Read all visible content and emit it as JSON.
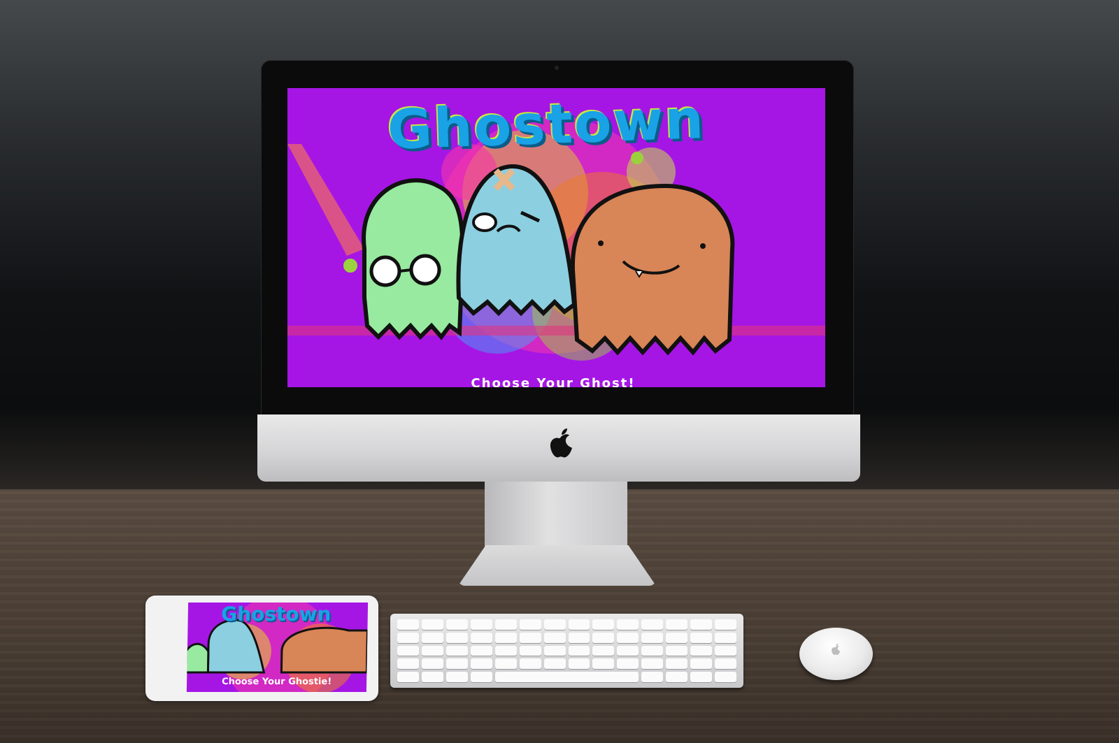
{
  "scene": {
    "imac_screen": {
      "title": "Ghostown",
      "caption": "Choose Your Ghost!"
    },
    "ipad_screen": {
      "title": "Ghostown",
      "caption": "Choose Your Ghostie!"
    }
  },
  "characters": [
    {
      "name": "green-ghost",
      "color": "#97ea9f"
    },
    {
      "name": "blue-ghost",
      "color": "#8ccfe0"
    },
    {
      "name": "orange-ghost",
      "color": "#d88557"
    }
  ],
  "colors": {
    "screen_background": "#a516e4",
    "title": "#19a2e6"
  },
  "icons": [
    "apple-logo-icon",
    "apple-logo-icon"
  ]
}
